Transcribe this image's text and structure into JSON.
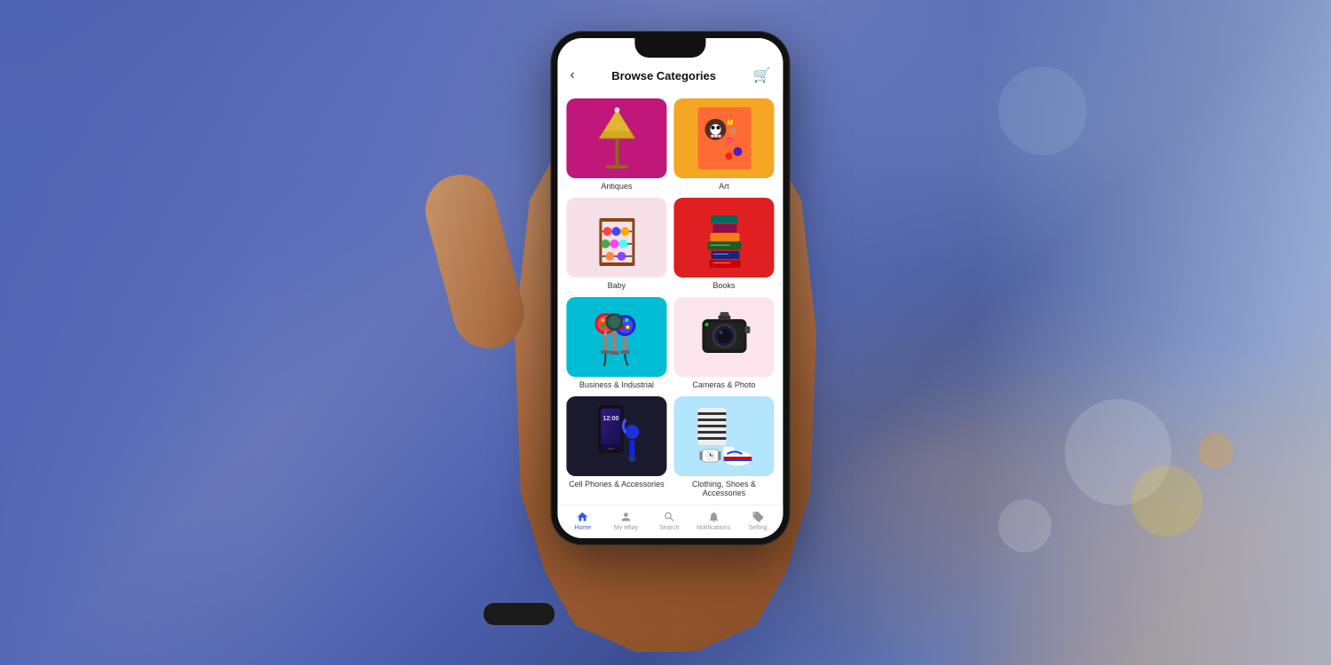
{
  "page": {
    "title": "Browse Categories",
    "background_description": "blurred city street background with blue tint"
  },
  "header": {
    "back_label": "‹",
    "title": "Browse Categories",
    "cart_icon": "cart"
  },
  "categories": [
    {
      "id": "antiques",
      "label": "Antiques",
      "bg_color": "#c0177a",
      "icon": "antiques-lamp"
    },
    {
      "id": "art",
      "label": "Art",
      "bg_color": "#f5a020",
      "icon": "art-painting"
    },
    {
      "id": "baby",
      "label": "Baby",
      "bg_color": "#f8e0e8",
      "icon": "baby-toy"
    },
    {
      "id": "books",
      "label": "Books",
      "bg_color": "#e02020",
      "icon": "books-stack"
    },
    {
      "id": "business",
      "label": "Business & Industrial",
      "bg_color": "#00bcd4",
      "icon": "gumball-machines"
    },
    {
      "id": "cameras",
      "label": "Cameras & Photo",
      "bg_color": "#fce4ec",
      "icon": "camera"
    },
    {
      "id": "electronics",
      "label": "Cell Phones & Accessories",
      "bg_color": "#0d0d2e",
      "icon": "smartphone"
    },
    {
      "id": "fashion",
      "label": "Clothing, Shoes & Accessories",
      "bg_color": "#b3e5fc",
      "icon": "fashion"
    }
  ],
  "bottom_nav": [
    {
      "id": "home",
      "label": "Home",
      "icon": "home",
      "active": true
    },
    {
      "id": "myebay",
      "label": "My eBay",
      "icon": "person",
      "active": false
    },
    {
      "id": "search",
      "label": "Search",
      "icon": "search",
      "active": false
    },
    {
      "id": "notifications",
      "label": "Notifications",
      "icon": "bell",
      "active": false
    },
    {
      "id": "selling",
      "label": "Selling",
      "icon": "tag",
      "active": false
    }
  ]
}
